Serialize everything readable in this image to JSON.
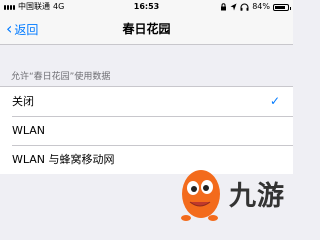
{
  "status_bar": {
    "carrier": "中国联通",
    "network": "4G",
    "time": "16:53",
    "battery_percent_label": "84%",
    "battery_level": 0.84
  },
  "nav": {
    "back_label": "返回",
    "title": "春日花园"
  },
  "section": {
    "header": "允许“春日花园”使用数据",
    "options": [
      {
        "label": "关闭",
        "selected": true
      },
      {
        "label": "WLAN",
        "selected": false
      },
      {
        "label": "WLAN 与蜂窝移动网",
        "selected": false
      }
    ]
  },
  "watermark": {
    "text": "九游"
  },
  "colors": {
    "accent": "#007aff",
    "logo_orange": "#f36b1c"
  }
}
